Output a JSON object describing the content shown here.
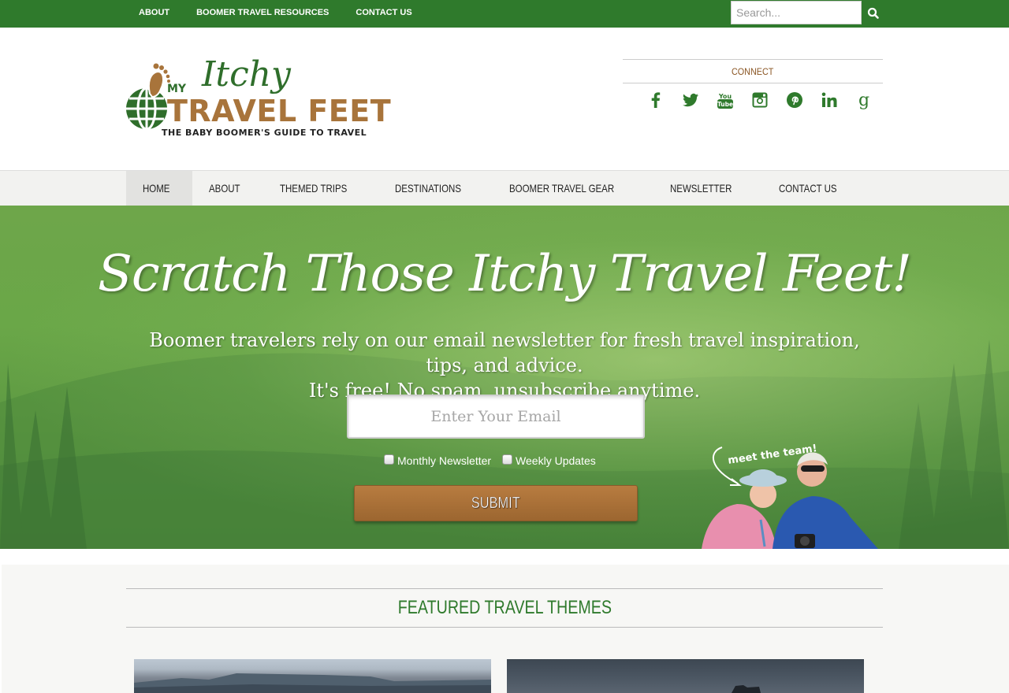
{
  "topbar": {
    "links": [
      "ABOUT",
      "BOOMER TRAVEL RESOURCES",
      "CONTACT US"
    ],
    "search_placeholder": "Search..."
  },
  "header": {
    "logo": {
      "my": "MY",
      "itchy": "Itchy",
      "travel_feet": "TRAVEL FEET",
      "tagline": "THE BABY BOOMER'S GUIDE TO TRAVEL"
    },
    "connect_label": "CONNECT",
    "social_icons": [
      "facebook-icon",
      "twitter-icon",
      "youtube-icon",
      "instagram-icon",
      "pinterest-icon",
      "linkedin-icon",
      "google-plus-icon"
    ]
  },
  "mainnav": {
    "items": [
      "HOME",
      "ABOUT",
      "THEMED TRIPS",
      "DESTINATIONS",
      "BOOMER TRAVEL GEAR",
      "NEWSLETTER",
      "CONTACT US"
    ],
    "active": "HOME"
  },
  "hero": {
    "title": "Scratch Those Itchy Travel Feet!",
    "subtitle_line1": "Boomer travelers rely on our email newsletter for fresh travel inspiration, tips, and advice.",
    "subtitle_line2": "It's free! No spam, unsubscribe anytime.",
    "email_placeholder": "Enter Your Email",
    "options": [
      "Monthly Newsletter",
      "Weekly Updates"
    ],
    "submit_label": "SUBMIT",
    "team_label": "meet the team!"
  },
  "featured": {
    "title": "FEATURED TRAVEL THEMES"
  },
  "colors": {
    "topbar": "#2f7a2c",
    "brand_green": "#2f7a2c",
    "brand_brown": "#a8743b",
    "connect_text": "#8a5523"
  }
}
